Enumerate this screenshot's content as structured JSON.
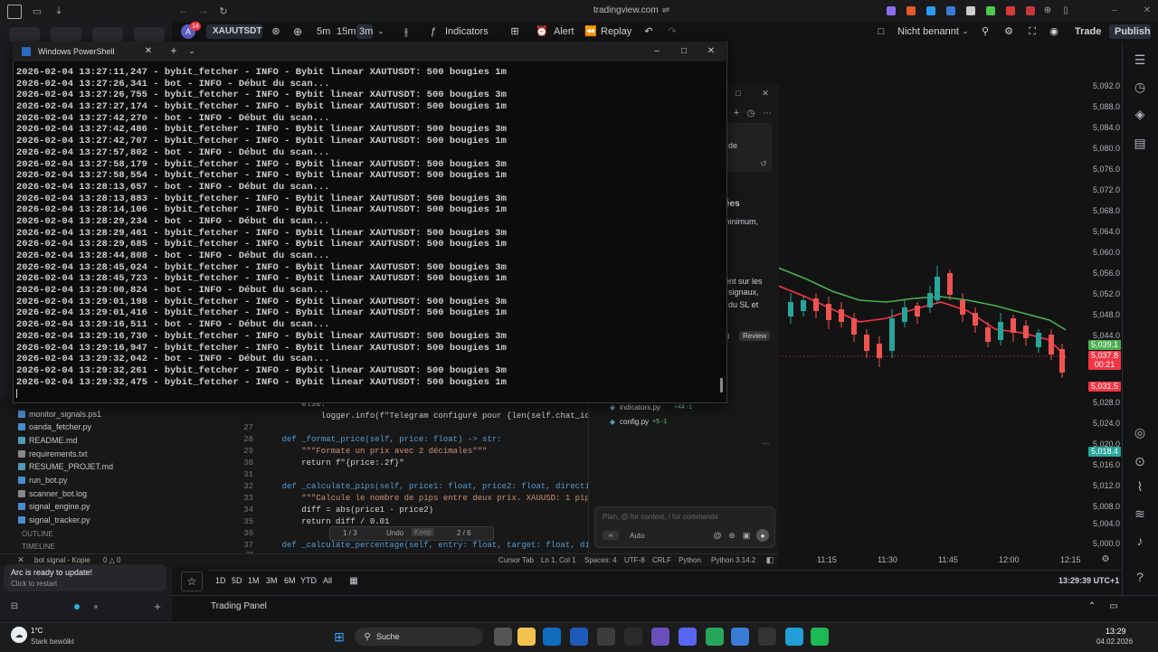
{
  "browser": {
    "url": "tradingview.com"
  },
  "tv_toolbar": {
    "symbol": "XAUUTSDT",
    "avatar_letter": "A",
    "notif_badge": "14",
    "timeframes": [
      "5m",
      "15m",
      "3m"
    ],
    "indicators_label": "Indicators",
    "alert_label": "Alert",
    "replay_label": "Replay",
    "layout_name": "Nicht benannt",
    "trade_label": "Trade",
    "publish_label": "Publish"
  },
  "powershell": {
    "title": "Windows PowerShell",
    "lines": [
      "2026-02-04 13:27:11,247 - bybit_fetcher - INFO - Bybit linear XAUTUSDT: 500 bougies 1m",
      "2026-02-04 13:27:26,341 - bot - INFO - Début du scan...",
      "2026-02-04 13:27:26,755 - bybit_fetcher - INFO - Bybit linear XAUTUSDT: 500 bougies 3m",
      "2026-02-04 13:27:27,174 - bybit_fetcher - INFO - Bybit linear XAUTUSDT: 500 bougies 1m",
      "2026-02-04 13:27:42,270 - bot - INFO - Début du scan...",
      "2026-02-04 13:27:42,486 - bybit_fetcher - INFO - Bybit linear XAUTUSDT: 500 bougies 3m",
      "2026-02-04 13:27:42,707 - bybit_fetcher - INFO - Bybit linear XAUTUSDT: 500 bougies 1m",
      "2026-02-04 13:27:57,802 - bot - INFO - Début du scan...",
      "2026-02-04 13:27:58,179 - bybit_fetcher - INFO - Bybit linear XAUTUSDT: 500 bougies 3m",
      "2026-02-04 13:27:58,554 - bybit_fetcher - INFO - Bybit linear XAUTUSDT: 500 bougies 1m",
      "2026-02-04 13:28:13,657 - bot - INFO - Début du scan...",
      "2026-02-04 13:28:13,883 - bybit_fetcher - INFO - Bybit linear XAUTUSDT: 500 bougies 3m",
      "2026-02-04 13:28:14,106 - bybit_fetcher - INFO - Bybit linear XAUTUSDT: 500 bougies 1m",
      "2026-02-04 13:28:29,234 - bot - INFO - Début du scan...",
      "2026-02-04 13:28:29,461 - bybit_fetcher - INFO - Bybit linear XAUTUSDT: 500 bougies 3m",
      "2026-02-04 13:28:29,685 - bybit_fetcher - INFO - Bybit linear XAUTUSDT: 500 bougies 1m",
      "2026-02-04 13:28:44,808 - bot - INFO - Début du scan...",
      "2026-02-04 13:28:45,024 - bybit_fetcher - INFO - Bybit linear XAUTUSDT: 500 bougies 3m",
      "2026-02-04 13:28:45,723 - bybit_fetcher - INFO - Bybit linear XAUTUSDT: 500 bougies 1m",
      "2026-02-04 13:29:00,824 - bot - INFO - Début du scan...",
      "2026-02-04 13:29:01,198 - bybit_fetcher - INFO - Bybit linear XAUTUSDT: 500 bougies 3m",
      "2026-02-04 13:29:01,416 - bybit_fetcher - INFO - Bybit linear XAUTUSDT: 500 bougies 1m",
      "2026-02-04 13:29:16,511 - bot - INFO - Début du scan...",
      "2026-02-04 13:29:16,730 - bybit_fetcher - INFO - Bybit linear XAUTUSDT: 500 bougies 3m",
      "2026-02-04 13:29:16,947 - bybit_fetcher - INFO - Bybit linear XAUTUSDT: 500 bougies 1m",
      "2026-02-04 13:29:32,042 - bot - INFO - Début du scan...",
      "2026-02-04 13:29:32,261 - bybit_fetcher - INFO - Bybit linear XAUTUSDT: 500 bougies 3m",
      "2026-02-04 13:29:32,475 - bybit_fetcher - INFO - Bybit linear XAUTUSDT: 500 bougies 1m"
    ]
  },
  "price_axis": [
    "5,092.0",
    "5,088.0",
    "5,084.0",
    "5,080.0",
    "5,076.0",
    "5,072.0",
    "5,068.0",
    "5,064.0",
    "5,060.0",
    "5,056.0",
    "5,052.0",
    "5,048.0",
    "5,044.0",
    "5,039.1",
    "5,037.8",
    "00:21",
    "5,031.5",
    "5,028.0",
    "5,024.0",
    "5,020.0",
    "5,016.0",
    "5,018.4",
    "5,012.0",
    "5,008.0",
    "5,004.0",
    "5,000.0"
  ],
  "price_labels": {
    "ma_green": "5,039.1",
    "last": "5,037.8",
    "countdown": "00:21",
    "ma_red": "5,031.5",
    "low": "5,018.4"
  },
  "time_axis": [
    "11:15",
    "11:30",
    "11:45",
    "12:00",
    "12:15"
  ],
  "timeframe_strip": [
    "1D",
    "5D",
    "1M",
    "3M",
    "6M",
    "YTD",
    "All"
  ],
  "clock_utc": "13:29:39 UTC+1",
  "trading_panel": "Trading Panel",
  "editor": {
    "lines": [
      {
        "n": "",
        "t": "        else:"
      },
      {
        "n": "",
        "t": "            logger.info(f\"Telegram configuré pour {len(self.chat_ids"
      },
      {
        "n": "27",
        "t": ""
      },
      {
        "n": "28",
        "t": "    def _format_price(self, price: float) -> str:"
      },
      {
        "n": "29",
        "t": "        \"\"\"Formate un prix avec 2 décimales\"\"\""
      },
      {
        "n": "30",
        "t": "        return f\"{price:.2f}\""
      },
      {
        "n": "31",
        "t": ""
      },
      {
        "n": "32",
        "t": "    def _calculate_pips(self, price1: float, price2: float, direction"
      },
      {
        "n": "33",
        "t": "        \"\"\"Calcule le nombre de pips entre deux prix. XAUUSD: 1 pip ="
      },
      {
        "n": "34",
        "t": "        diff = abs(price1 - price2)"
      },
      {
        "n": "35",
        "t": "        return diff / 0.01"
      },
      {
        "n": "36",
        "t": ""
      },
      {
        "n": "37",
        "t": "    def _calculate_percentage(self, entry: float, target: float, dire"
      },
      {
        "n": "38",
        "t": "        \"\"\"Calcule le pourcentage de profit/perte\"\"\""
      }
    ],
    "find_widget": {
      "count": "1 / 3",
      "undo": "Undo",
      "keep": "Keep",
      "nav": "2 / 6"
    }
  },
  "explorer": {
    "files": [
      "monitor_signals.ps1",
      "oanda_fetcher.py",
      "README.md",
      "requirements.txt",
      "RESUME_PROJET.md",
      "run_bot.py",
      "scanner_bot.log",
      "signal_engine.py",
      "signal_tracker.py"
    ],
    "outline": "OUTLINE",
    "timeline": "TIMELINE"
  },
  "vs_status": {
    "branch": "bot signal - Kopie",
    "problems": "0 △ 0",
    "cursor_tab": "Cursor Tab",
    "position": "Ln 1, Col 1",
    "spaces": "Spaces: 4",
    "encoding": "UTF-8",
    "eol": "CRLF",
    "language": "Python",
    "python_version": "Python 3.14.2"
  },
  "copilot": {
    "heading_partial": "ées",
    "text1": "minimum,",
    "text2": "ent sur les",
    "text3": "signaux,",
    "text4": "du SL et",
    "text5": "de",
    "tab_all": "ll",
    "tab_review": "Review",
    "changed_files": [
      {
        "name": "indicators.py",
        "diff": "+44 -1"
      },
      {
        "name": "config.py",
        "diff": "+5 -1"
      }
    ],
    "input_placeholder": "Plan, @ for context, / for commands",
    "mode": "Auto"
  },
  "arc": {
    "toast_title": "Arc is ready to update!",
    "toast_sub": "Click to restart"
  },
  "taskbar": {
    "search": "Suche",
    "weather_temp": "1°C",
    "weather_text": "Stark bewölkt",
    "time": "13:29",
    "date": "04.02.2026"
  },
  "colors": {
    "green_ma": "#4caf50",
    "red_ma": "#f23645",
    "up_candle": "#26a69a",
    "down_candle": "#ef5350"
  }
}
